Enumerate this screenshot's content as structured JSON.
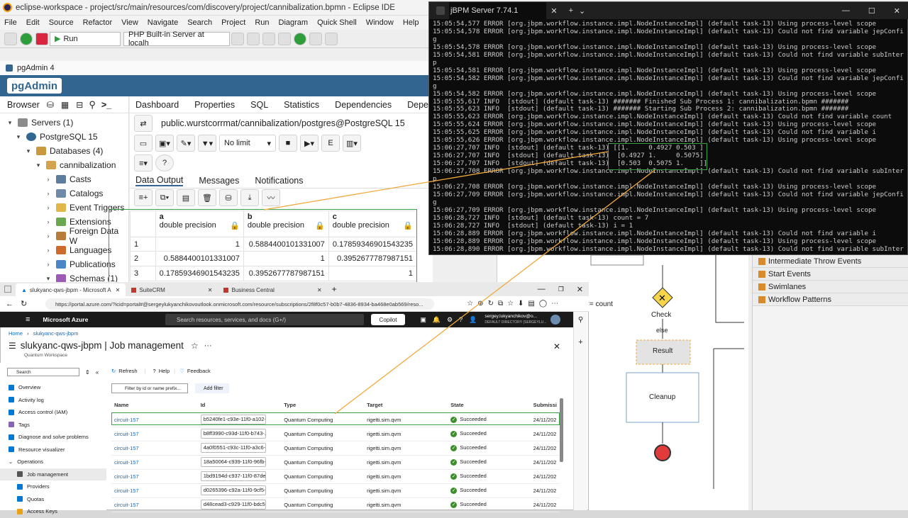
{
  "eclipse": {
    "title": "eclipse-workspace - project/src/main/resources/com/discovery/project/cannibalization.bpmn - Eclipse IDE",
    "menu": [
      "File",
      "Edit",
      "Source",
      "Refactor",
      "View",
      "Navigate",
      "Search",
      "Project",
      "Run",
      "Diagram",
      "Quick Shell",
      "Window",
      "Help"
    ],
    "run_combo": "Run",
    "server_combo": "PHP Built-in Server at localh"
  },
  "pgadmin": {
    "title": "pgAdmin 4",
    "logo": "pgAdmin",
    "browser_label": "Browser",
    "tabs": [
      "Dashboard",
      "Properties",
      "SQL",
      "Statistics",
      "Dependencies",
      "Dependents"
    ],
    "connection": "public.wurstcorrmat/cannibalization/postgres@PostgreSQL 15",
    "limit": "No limit",
    "result_tabs": [
      "Data Output",
      "Messages",
      "Notifications"
    ],
    "tree": [
      {
        "label": "Servers (1)"
      },
      {
        "label": "PostgreSQL 15"
      },
      {
        "label": "Databases (4)"
      },
      {
        "label": "cannibalization"
      },
      {
        "label": "Casts"
      },
      {
        "label": "Catalogs"
      },
      {
        "label": "Event Triggers"
      },
      {
        "label": "Extensions"
      },
      {
        "label": "Foreign Data W"
      },
      {
        "label": "Languages"
      },
      {
        "label": "Publications"
      },
      {
        "label": "Schemas (1)"
      }
    ],
    "grid": {
      "columns": [
        {
          "name": "a",
          "type": "double precision"
        },
        {
          "name": "b",
          "type": "double precision"
        },
        {
          "name": "c",
          "type": "double precision"
        }
      ],
      "rows": [
        {
          "n": "1",
          "a": "1",
          "b": "0.5884400101331007",
          "c": "0.17859346901543235"
        },
        {
          "n": "2",
          "a": "0.5884400101331007",
          "b": "1",
          "c": "0.3952677787987151"
        },
        {
          "n": "3",
          "a": "0.17859346901543235",
          "b": "0.3952677787987151",
          "c": "1"
        }
      ]
    }
  },
  "terminal": {
    "title": "jBPM Server 7.74.1",
    "lines": [
      "15:05:54,577 ERROR [org.jbpm.workflow.instance.impl.NodeInstanceImpl] (default task-13) Using process-level scope",
      "15:05:54,578 ERROR [org.jbpm.workflow.instance.impl.NodeInstanceImpl] (default task-13) Could not find variable jepConfi",
      "g",
      "15:05:54,578 ERROR [org.jbpm.workflow.instance.impl.NodeInstanceImpl] (default task-13) Using process-level scope",
      "15:05:54,581 ERROR [org.jbpm.workflow.instance.impl.NodeInstanceImpl] (default task-13) Could not find variable subInter",
      "p",
      "15:05:54,581 ERROR [org.jbpm.workflow.instance.impl.NodeInstanceImpl] (default task-13) Using process-level scope",
      "15:05:54,582 ERROR [org.jbpm.workflow.instance.impl.NodeInstanceImpl] (default task-13) Could not find variable jepConfi",
      "g",
      "15:05:54,582 ERROR [org.jbpm.workflow.instance.impl.NodeInstanceImpl] (default task-13) Using process-level scope",
      "15:05:55,617 INFO  [stdout] (default task-13) ####### Finished Sub Process 1: cannibalization.bpmn #######",
      "15:05:55,623 INFO  [stdout] (default task-13) ####### Starting Sub Process 2: cannibalization.bpmn #######",
      "15:05:55,623 ERROR [org.jbpm.workflow.instance.impl.NodeInstanceImpl] (default task-13) Could not find variable count",
      "15:05:55,624 ERROR [org.jbpm.workflow.instance.impl.NodeInstanceImpl] (default task-13) Using process-level scope",
      "15:05:55,625 ERROR [org.jbpm.workflow.instance.impl.NodeInstanceImpl] (default task-13) Could not find variable i",
      "15:05:55,626 ERROR [org.jbpm.workflow.instance.impl.NodeInstanceImpl] (default task-13) Using process-level scope",
      "15:06:27,707 INFO  [stdout] (default task-13) [[1.     0.4927 0.503 ]",
      "15:06:27,707 INFO  [stdout] (default task-13)  [0.4927 1.     0.5075]",
      "15:06:27,707 INFO  [stdout] (default task-13)  [0.503  0.5075 1.    ]]",
      "15:06:27,708 ERROR [org.jbpm.workflow.instance.impl.NodeInstanceImpl] (default task-13) Could not find variable subInter",
      "p",
      "15:06:27,708 ERROR [org.jbpm.workflow.instance.impl.NodeInstanceImpl] (default task-13) Using process-level scope",
      "15:06:27,709 ERROR [org.jbpm.workflow.instance.impl.NodeInstanceImpl] (default task-13) Could not find variable jepConfi",
      "g",
      "15:06:27,709 ERROR [org.jbpm.workflow.instance.impl.NodeInstanceImpl] (default task-13) Using process-level scope",
      "15:06:28,727 INFO  [stdout] (default task-13) count = 7",
      "15:06:28,727 INFO  [stdout] (default task-13) i = 1",
      "15:06:28,889 ERROR [org.jbpm.workflow.instance.impl.NodeInstanceImpl] (default task-13) Could not find variable i",
      "15:06:28,889 ERROR [org.jbpm.workflow.instance.impl.NodeInstanceImpl] (default task-13) Using process-level scope",
      "15:06:28,890 ERROR [org.jbpm.workflow.instance.impl.NodeInstanceImpl] (default task-13) Could not find variable subInter"
    ]
  },
  "bpmn": {
    "gateway_label": "Check",
    "else_label": "else",
    "count_label": "<= count",
    "result_task": "Result",
    "cleanup_task": "Cleanup",
    "palette": [
      "Intermediate Throw Events",
      "Start Events",
      "Swimlanes",
      "Workflow Patterns"
    ]
  },
  "edge": {
    "tabs": [
      "slukyanc-qws-jbpm - Microsoft A",
      "SuiteCRM",
      "Business Central"
    ],
    "address": "https://portal.azure.com/?icid=portal#@sergeylukyanchikovoutlook.onmicrosoft.com/resource/subscriptions/2f8f0c57-b0b7-4836-8934-ba468e0ab569/reso..."
  },
  "azure": {
    "brand": "Microsoft Azure",
    "search_placeholder": "Search resources, services, and docs (G+/)",
    "copilot": "Copilot",
    "user": "sergey.lukyanchikov@o...",
    "directory": "DEFAULT DIRECTORY (SERGEYLU...",
    "breadcrumb_home": "Home",
    "breadcrumb_resource": "slukyanc-qws-jbpm",
    "page_title": "slukyanc-qws-jbpm | Job management",
    "subtitle": "Quantum Workspace",
    "side_search": "Search",
    "refresh": "Refresh",
    "help": "Help",
    "feedback": "Feedback",
    "filter_placeholder": "Filter by id or name prefix...",
    "add_filter": "Add filter",
    "nav": [
      "Overview",
      "Activity log",
      "Access control (IAM)",
      "Tags",
      "Diagnose and solve problems",
      "Resource visualizer",
      "Operations",
      "Job management",
      "Providers",
      "Quotas",
      "Access Keys"
    ],
    "columns": [
      "Name",
      "Id",
      "Type",
      "Target",
      "State",
      "Submissi"
    ],
    "jobs": [
      {
        "name": "circuit-157",
        "id": "b5240fe1-c93e-11f0-a102-...",
        "type": "Quantum Computing",
        "target": "rigetti.sim.qvm",
        "state": "Succeeded",
        "date": "24/11/202"
      },
      {
        "name": "circuit-157",
        "id": "b8ff3990-c93d-11f0-b743-...",
        "type": "Quantum Computing",
        "target": "rigetti.sim.qvm",
        "state": "Succeeded",
        "date": "24/11/202"
      },
      {
        "name": "circuit-157",
        "id": "4a0f0551-c93c-11f0-a3c6-...",
        "type": "Quantum Computing",
        "target": "rigetti.sim.qvm",
        "state": "Succeeded",
        "date": "24/11/202"
      },
      {
        "name": "circuit-157",
        "id": "18a50064-c939-11f0-96fb-...",
        "type": "Quantum Computing",
        "target": "rigetti.sim.qvm",
        "state": "Succeeded",
        "date": "24/11/202"
      },
      {
        "name": "circuit-157",
        "id": "1bd9194d-c937-11f0-87de-...",
        "type": "Quantum Computing",
        "target": "rigetti.sim.qvm",
        "state": "Succeeded",
        "date": "24/11/202"
      },
      {
        "name": "circuit-157",
        "id": "d0265396-c92a-11f0-9cf5-...",
        "type": "Quantum Computing",
        "target": "rigetti.sim.qvm",
        "state": "Succeeded",
        "date": "24/11/202"
      },
      {
        "name": "circuit-157",
        "id": "d48cead3-c929-11f0-bdc5-...",
        "type": "Quantum Computing",
        "target": "rigetti.sim.qvm",
        "state": "Succeeded",
        "date": "24/11/202"
      }
    ]
  },
  "colors": {
    "highlight": "#3aa14a",
    "connector": "#f2a93b",
    "pg_header": "#326690",
    "azure_bar": "#1b1b1b"
  }
}
